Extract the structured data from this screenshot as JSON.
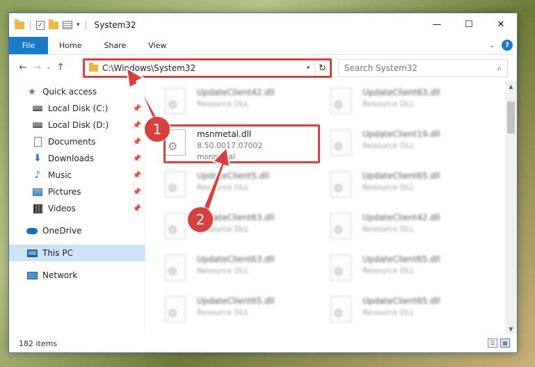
{
  "window": {
    "title": "System32",
    "controls": {
      "minimize": "—",
      "maximize": "☐",
      "close": "✕"
    }
  },
  "ribbon": {
    "tabs": [
      {
        "label": "File"
      },
      {
        "label": "Home"
      },
      {
        "label": "Share"
      },
      {
        "label": "View"
      }
    ],
    "help": "?"
  },
  "nav": {
    "back": "←",
    "forward": "→",
    "recent": "⌄",
    "up": "↑",
    "address": "C:\\Windows\\System32",
    "refresh": "↻",
    "search_placeholder": "Search System32"
  },
  "sidebar": {
    "items": [
      {
        "label": "Quick access",
        "icon": "star-icon"
      },
      {
        "label": "Local Disk (C:)",
        "icon": "disk-icon",
        "pinned": true
      },
      {
        "label": "Local Disk (D:)",
        "icon": "disk-icon",
        "pinned": true
      },
      {
        "label": "Documents",
        "icon": "documents-icon",
        "pinned": true
      },
      {
        "label": "Downloads",
        "icon": "downloads-icon",
        "pinned": true
      },
      {
        "label": "Music",
        "icon": "music-icon",
        "pinned": true
      },
      {
        "label": "Pictures",
        "icon": "pictures-icon",
        "pinned": true
      },
      {
        "label": "Videos",
        "icon": "videos-icon",
        "pinned": true
      },
      {
        "label": "OneDrive",
        "icon": "cloud-icon"
      },
      {
        "label": "This PC",
        "icon": "computer-icon",
        "selected": true
      },
      {
        "label": "Network",
        "icon": "network-icon"
      }
    ]
  },
  "files": {
    "highlighted": {
      "name": "msnmetal.dll",
      "version": "8.50.0017.07002",
      "description": "msnmetal"
    },
    "left_column": [
      {
        "name": "UpdateClient42.dll",
        "type": "Resource DLL"
      },
      {
        "name": "UpdateClient5.dll",
        "type": "Resource DLL"
      },
      {
        "name": "UpdateClient63.dll",
        "type": "Resource DLL"
      },
      {
        "name": "UpdateClient63.dll",
        "type": "Resource DLL"
      },
      {
        "name": "UpdateClient65.dll",
        "type": "Resource DLL"
      }
    ],
    "right_column": [
      {
        "name": "UpdateClient63.dll",
        "type": "Resource DLL"
      },
      {
        "name": "UpdateClient19.dll",
        "type": "Resource DLL"
      },
      {
        "name": "UpdateClient65.dll",
        "type": "Resource DLL"
      },
      {
        "name": "UpdateClient42.dll",
        "type": "Resource DLL"
      },
      {
        "name": "UpdateClient65.dll",
        "type": "Resource DLL"
      },
      {
        "name": "UpdateClient65.dll",
        "type": "Resource DLL"
      }
    ]
  },
  "status": {
    "item_count": "182 items"
  },
  "callouts": {
    "step1": "1",
    "step2": "2"
  },
  "colors": {
    "highlight": "#d8403f",
    "accent": "#1979ca",
    "selected": "#cce4f7"
  }
}
